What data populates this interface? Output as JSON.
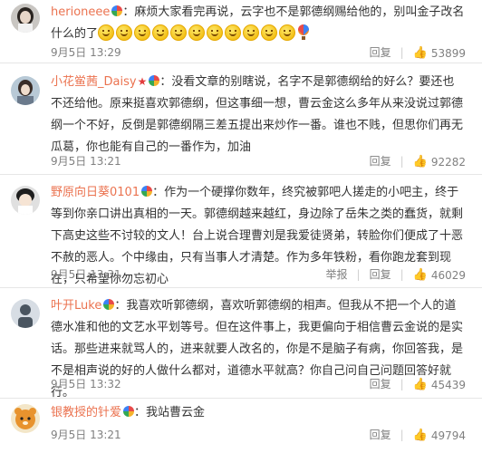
{
  "comments": [
    {
      "user": "herioneee",
      "text": "：麻烦大家看完再说，云字也不是郭德纲赐给他的，别叫金子改名什么的了",
      "emoji_count": 11,
      "time": "9月5日 13:29",
      "reply": "回复",
      "likes": "53899"
    },
    {
      "user": "小花鲎茜_Daisy",
      "text": "：没看文章的别瞎说，名字不是郭德纲给的好么？要还也不还给他。原来挺喜欢郭德纲，但这事细一想，曹云金这么多年从来没说过郭德纲一个不好，反倒是郭德纲隔三差五提出来炒作一番。谁也不贱，但思你们再无瓜葛，你也能有自己的一番作为，加油",
      "time": "9月5日 13:21",
      "reply": "回复",
      "likes": "92282"
    },
    {
      "user": "野原向日葵0101",
      "text": "：作为一个硬撑你数年，终究被郭吧人搓走的小吧主，终于等到你亲口讲出真相的一天。郭德纲越来越红，身边除了岳朱之类的蠢货，就剩下高史这些不讨较的文人！台上说合理曹刘是我爱徒贤弟，转脸你们便成了十恶不赦的恶人。个中缘由，只有当事人才清楚。作为多年铁粉，看你跑龙套到现在，只希望你勿忘初心",
      "time": "9月5日 13:31",
      "report": "举报",
      "reply": "回复",
      "likes": "46029"
    },
    {
      "user": "叶开Luke",
      "text": "：我喜欢听郭德纲，喜欢听郭德纲的相声。但我从不把一个人的道德水准和他的文艺水平划等号。但在这件事上，我更偏向于相信曹云金说的是实话。那些进来就骂人的，进来就要人改名的，你是不是脑子有病，你回答我，是不是相声说的好的人做什么都对，道德水平就高？你自己问自己问题回答好就行。",
      "time": "9月5日 13:32",
      "reply": "回复",
      "likes": "45439"
    },
    {
      "user": "银教授的针爱",
      "text": "：我站曹云金",
      "time": "9月5日 13:21",
      "reply": "回复",
      "likes": "49794"
    }
  ],
  "icons": {
    "like": "thumbs-up-icon",
    "badge": "rainbow-badge-icon",
    "star": "red-star-icon"
  }
}
